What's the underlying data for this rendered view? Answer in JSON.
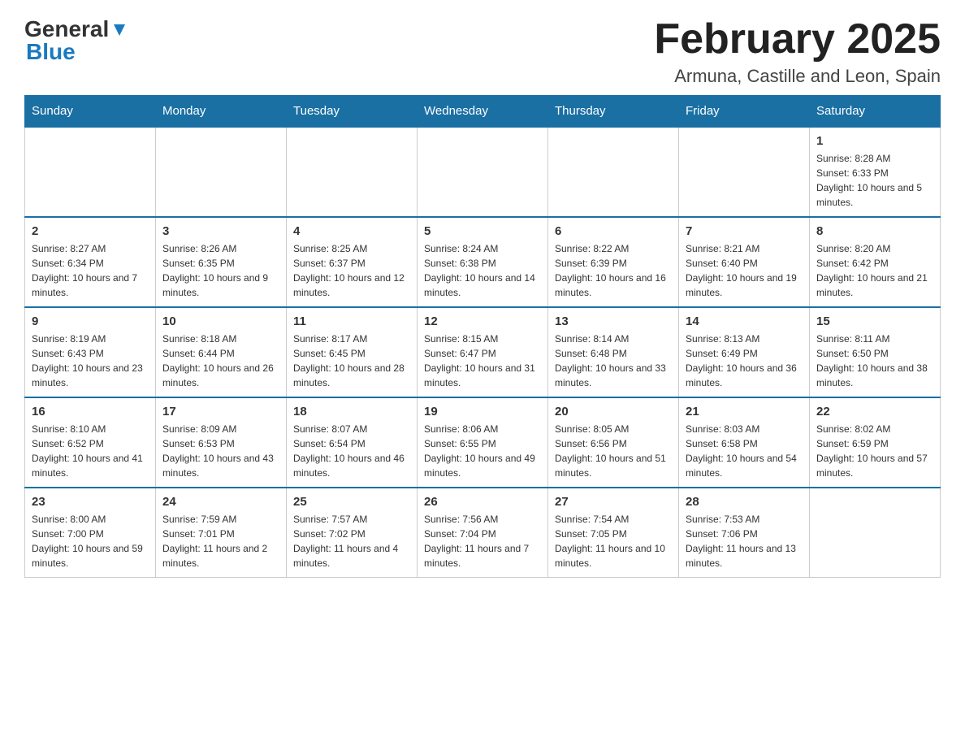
{
  "header": {
    "logo": {
      "general": "General",
      "blue": "Blue"
    },
    "title": "February 2025",
    "location": "Armuna, Castille and Leon, Spain"
  },
  "days_of_week": [
    "Sunday",
    "Monday",
    "Tuesday",
    "Wednesday",
    "Thursday",
    "Friday",
    "Saturday"
  ],
  "weeks": [
    {
      "days": [
        {
          "num": "",
          "info": ""
        },
        {
          "num": "",
          "info": ""
        },
        {
          "num": "",
          "info": ""
        },
        {
          "num": "",
          "info": ""
        },
        {
          "num": "",
          "info": ""
        },
        {
          "num": "",
          "info": ""
        },
        {
          "num": "1",
          "info": "Sunrise: 8:28 AM\nSunset: 6:33 PM\nDaylight: 10 hours and 5 minutes."
        }
      ]
    },
    {
      "days": [
        {
          "num": "2",
          "info": "Sunrise: 8:27 AM\nSunset: 6:34 PM\nDaylight: 10 hours and 7 minutes."
        },
        {
          "num": "3",
          "info": "Sunrise: 8:26 AM\nSunset: 6:35 PM\nDaylight: 10 hours and 9 minutes."
        },
        {
          "num": "4",
          "info": "Sunrise: 8:25 AM\nSunset: 6:37 PM\nDaylight: 10 hours and 12 minutes."
        },
        {
          "num": "5",
          "info": "Sunrise: 8:24 AM\nSunset: 6:38 PM\nDaylight: 10 hours and 14 minutes."
        },
        {
          "num": "6",
          "info": "Sunrise: 8:22 AM\nSunset: 6:39 PM\nDaylight: 10 hours and 16 minutes."
        },
        {
          "num": "7",
          "info": "Sunrise: 8:21 AM\nSunset: 6:40 PM\nDaylight: 10 hours and 19 minutes."
        },
        {
          "num": "8",
          "info": "Sunrise: 8:20 AM\nSunset: 6:42 PM\nDaylight: 10 hours and 21 minutes."
        }
      ]
    },
    {
      "days": [
        {
          "num": "9",
          "info": "Sunrise: 8:19 AM\nSunset: 6:43 PM\nDaylight: 10 hours and 23 minutes."
        },
        {
          "num": "10",
          "info": "Sunrise: 8:18 AM\nSunset: 6:44 PM\nDaylight: 10 hours and 26 minutes."
        },
        {
          "num": "11",
          "info": "Sunrise: 8:17 AM\nSunset: 6:45 PM\nDaylight: 10 hours and 28 minutes."
        },
        {
          "num": "12",
          "info": "Sunrise: 8:15 AM\nSunset: 6:47 PM\nDaylight: 10 hours and 31 minutes."
        },
        {
          "num": "13",
          "info": "Sunrise: 8:14 AM\nSunset: 6:48 PM\nDaylight: 10 hours and 33 minutes."
        },
        {
          "num": "14",
          "info": "Sunrise: 8:13 AM\nSunset: 6:49 PM\nDaylight: 10 hours and 36 minutes."
        },
        {
          "num": "15",
          "info": "Sunrise: 8:11 AM\nSunset: 6:50 PM\nDaylight: 10 hours and 38 minutes."
        }
      ]
    },
    {
      "days": [
        {
          "num": "16",
          "info": "Sunrise: 8:10 AM\nSunset: 6:52 PM\nDaylight: 10 hours and 41 minutes."
        },
        {
          "num": "17",
          "info": "Sunrise: 8:09 AM\nSunset: 6:53 PM\nDaylight: 10 hours and 43 minutes."
        },
        {
          "num": "18",
          "info": "Sunrise: 8:07 AM\nSunset: 6:54 PM\nDaylight: 10 hours and 46 minutes."
        },
        {
          "num": "19",
          "info": "Sunrise: 8:06 AM\nSunset: 6:55 PM\nDaylight: 10 hours and 49 minutes."
        },
        {
          "num": "20",
          "info": "Sunrise: 8:05 AM\nSunset: 6:56 PM\nDaylight: 10 hours and 51 minutes."
        },
        {
          "num": "21",
          "info": "Sunrise: 8:03 AM\nSunset: 6:58 PM\nDaylight: 10 hours and 54 minutes."
        },
        {
          "num": "22",
          "info": "Sunrise: 8:02 AM\nSunset: 6:59 PM\nDaylight: 10 hours and 57 minutes."
        }
      ]
    },
    {
      "days": [
        {
          "num": "23",
          "info": "Sunrise: 8:00 AM\nSunset: 7:00 PM\nDaylight: 10 hours and 59 minutes."
        },
        {
          "num": "24",
          "info": "Sunrise: 7:59 AM\nSunset: 7:01 PM\nDaylight: 11 hours and 2 minutes."
        },
        {
          "num": "25",
          "info": "Sunrise: 7:57 AM\nSunset: 7:02 PM\nDaylight: 11 hours and 4 minutes."
        },
        {
          "num": "26",
          "info": "Sunrise: 7:56 AM\nSunset: 7:04 PM\nDaylight: 11 hours and 7 minutes."
        },
        {
          "num": "27",
          "info": "Sunrise: 7:54 AM\nSunset: 7:05 PM\nDaylight: 11 hours and 10 minutes."
        },
        {
          "num": "28",
          "info": "Sunrise: 7:53 AM\nSunset: 7:06 PM\nDaylight: 11 hours and 13 minutes."
        },
        {
          "num": "",
          "info": ""
        }
      ]
    }
  ]
}
